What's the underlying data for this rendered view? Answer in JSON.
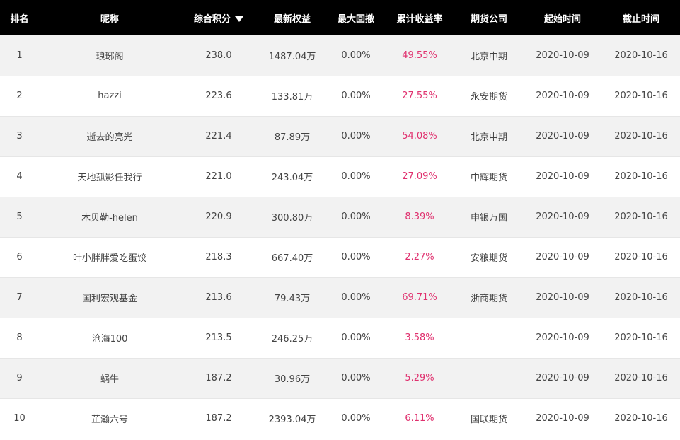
{
  "colors": {
    "header_bg": "#000000",
    "header_text": "#ffffff",
    "rate": "#e0306e",
    "row_alt": "#f2f2f2"
  },
  "headers": [
    "排名",
    "昵称",
    "综合积分",
    "最新权益",
    "最大回撤",
    "累计收益率",
    "期货公司",
    "起始时间",
    "截止时间"
  ],
  "sort_icon": "triangle-down-icon",
  "rows": [
    {
      "rank": "1",
      "name": "琅琊阁",
      "score": "238.0",
      "equity": "1487.04万",
      "drawdown": "0.00%",
      "rate": "49.55%",
      "company": "北京中期",
      "start": "2020-10-09",
      "end": "2020-10-16"
    },
    {
      "rank": "2",
      "name": "hazzi",
      "score": "223.6",
      "equity": "133.81万",
      "drawdown": "0.00%",
      "rate": "27.55%",
      "company": "永安期货",
      "start": "2020-10-09",
      "end": "2020-10-16"
    },
    {
      "rank": "3",
      "name": "逝去的亮光",
      "score": "221.4",
      "equity": "87.89万",
      "drawdown": "0.00%",
      "rate": "54.08%",
      "company": "北京中期",
      "start": "2020-10-09",
      "end": "2020-10-16"
    },
    {
      "rank": "4",
      "name": "天地孤影任我行",
      "score": "221.0",
      "equity": "243.04万",
      "drawdown": "0.00%",
      "rate": "27.09%",
      "company": "中辉期货",
      "start": "2020-10-09",
      "end": "2020-10-16"
    },
    {
      "rank": "5",
      "name": "木贝勒-helen",
      "score": "220.9",
      "equity": "300.80万",
      "drawdown": "0.00%",
      "rate": "8.39%",
      "company": "申银万国",
      "start": "2020-10-09",
      "end": "2020-10-16"
    },
    {
      "rank": "6",
      "name": "叶小胖胖爱吃蛋饺",
      "score": "218.3",
      "equity": "667.40万",
      "drawdown": "0.00%",
      "rate": "2.27%",
      "company": "安粮期货",
      "start": "2020-10-09",
      "end": "2020-10-16"
    },
    {
      "rank": "7",
      "name": "国利宏观基金",
      "score": "213.6",
      "equity": "79.43万",
      "drawdown": "0.00%",
      "rate": "69.71%",
      "company": "浙商期货",
      "start": "2020-10-09",
      "end": "2020-10-16"
    },
    {
      "rank": "8",
      "name": "沧海100",
      "score": "213.5",
      "equity": "246.25万",
      "drawdown": "0.00%",
      "rate": "3.58%",
      "company": "",
      "start": "2020-10-09",
      "end": "2020-10-16"
    },
    {
      "rank": "9",
      "name": "蜗牛",
      "score": "187.2",
      "equity": "30.96万",
      "drawdown": "0.00%",
      "rate": "5.29%",
      "company": "",
      "start": "2020-10-09",
      "end": "2020-10-16"
    },
    {
      "rank": "10",
      "name": "芷瀚六号",
      "score": "187.2",
      "equity": "2393.04万",
      "drawdown": "0.00%",
      "rate": "6.11%",
      "company": "国联期货",
      "start": "2020-10-09",
      "end": "2020-10-16"
    }
  ]
}
